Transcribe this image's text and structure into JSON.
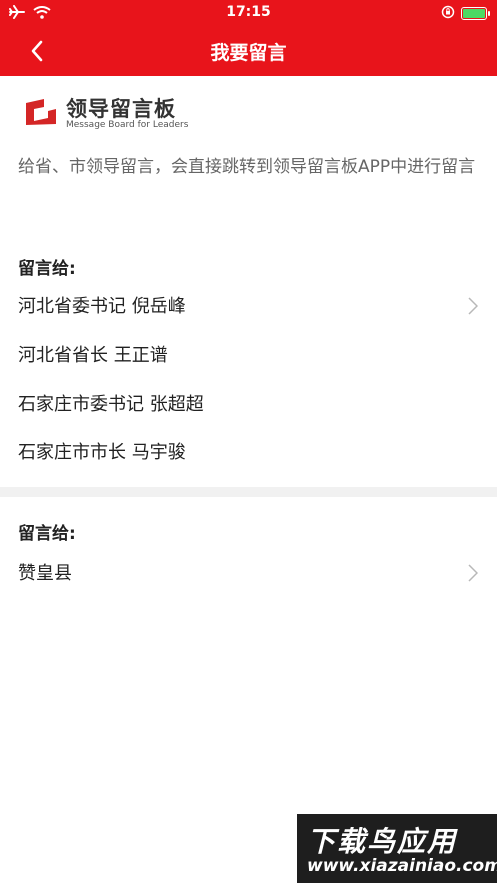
{
  "status_bar": {
    "time": "17:15",
    "battery_level": 1.0
  },
  "nav": {
    "title": "我要留言",
    "back_icon": "chevron-left-icon"
  },
  "logo": {
    "cn": "领导留言板",
    "en": "Message Board for Leaders",
    "accent_color": "#d42626"
  },
  "description": "给省、市领导留言，会直接跳转到领导留言板APP中进行留言",
  "sections": [
    {
      "label": "留言给:",
      "items": [
        {
          "text": "河北省委书记  倪岳峰",
          "chevron": true
        },
        {
          "text": "河北省省长  王正谱",
          "chevron": false
        },
        {
          "text": "石家庄市委书记  张超超",
          "chevron": false
        },
        {
          "text": "石家庄市市长  马宇骏",
          "chevron": false
        }
      ]
    },
    {
      "label": "留言给:",
      "items": [
        {
          "text": "赞皇县",
          "chevron": true
        }
      ]
    }
  ],
  "watermark": {
    "line1": "下载鸟应用",
    "line2": "www.xiazainiao.com"
  },
  "colors": {
    "header": "#e8141b",
    "separator": "#f1f1f1"
  }
}
